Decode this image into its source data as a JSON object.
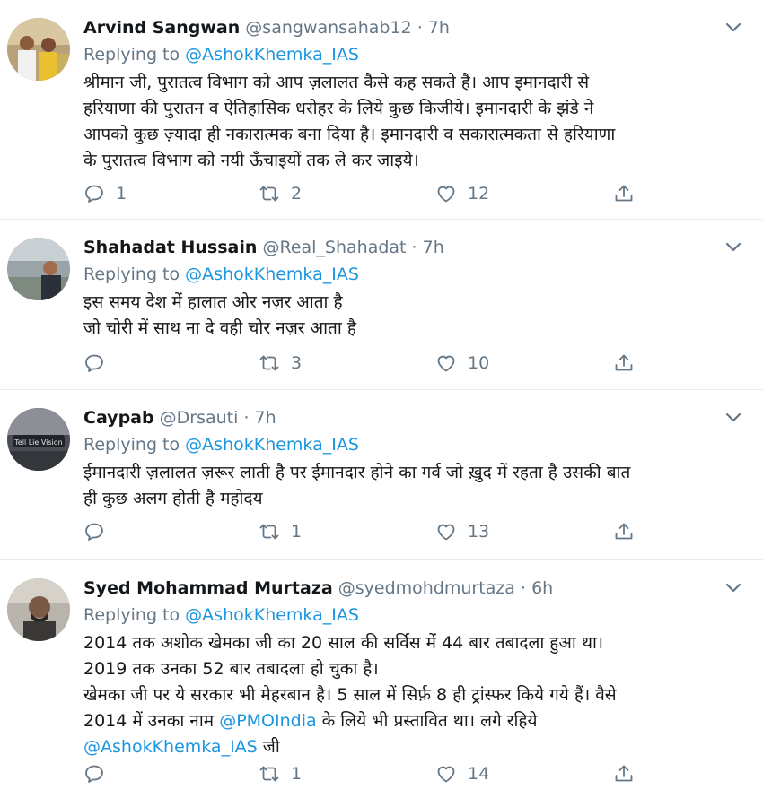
{
  "tweets": [
    {
      "name": "Arvind Sangwan",
      "handle": "@sangwansahab12",
      "sep": "·",
      "time": "7h",
      "replying_prefix": "Replying to",
      "replying_to": "@AshokKhemka_IAS",
      "lines": [
        "श्रीमान जी, पुरातत्व विभाग को आप ज़लालत कैसे कह सकते हैं। आप इमानदारी से",
        "हरियाणा की पुरातन व ऐतिहासिक धरोहर के लिये कुछ किजीये। इमानदारी के झंडे ने",
        "आपको कुछ ज़्यादा ही नकारात्मक बना दिया है। इमानदारी व सकारात्मकता से हरियाणा",
        "के पुरातत्व विभाग को नयी ऊँचाइयों तक ले कर जाइये।"
      ],
      "replies": "1",
      "retweets": "2",
      "likes": "12"
    },
    {
      "name": "Shahadat Hussain",
      "handle": "@Real_Shahadat",
      "sep": "·",
      "time": "7h",
      "replying_prefix": "Replying to",
      "replying_to": "@AshokKhemka_IAS",
      "lines": [
        "इस समय देश में  हालात ओर नज़र आता है",
        "जो चोरी में साथ ना दे वही चोर नज़र आता है"
      ],
      "replies": "",
      "retweets": "3",
      "likes": "10"
    },
    {
      "name": "Caypab",
      "handle": "@Drsauti",
      "sep": "·",
      "time": "7h",
      "replying_prefix": "Replying to",
      "replying_to": "@AshokKhemka_IAS",
      "lines": [
        "ईमानदारी ज़लालत ज़रूर लाती है पर ईमानदार होने का गर्व जो ख़ुद में रहता है उसकी बात",
        "ही कुछ अलग होती है महोदय"
      ],
      "replies": "",
      "retweets": "1",
      "likes": "13"
    },
    {
      "name": "Syed Mohammad Murtaza",
      "handle": "@syedmohdmurtaza",
      "sep": "·",
      "time": "6h",
      "replying_prefix": "Replying to",
      "replying_to": "@AshokKhemka_IAS",
      "lines": [
        "2014 तक अशोक खेमका जी का 20 साल की सर्विस में 44 बार तबादला हुआ था।",
        "2019 तक उनका 52 बार तबादला हो चुका है।",
        "खेमका जी पर ये सरकार भी मेहरबान है। 5 साल में सिर्फ़ 8 ही ट्रांस्फर किये गये हैं। वैसे"
      ],
      "line4_before": "2014 में उनका नाम ",
      "line4_mention": "@PMOIndia",
      "line4_after": " के लिये भी प्रस्तावित था। लगे रहिये",
      "line5_mention": "@AshokKhemka_IAS",
      "line5_after": " जी",
      "replies": "",
      "retweets": "1",
      "likes": "14"
    }
  ],
  "colors": {
    "text": "#14171a",
    "muted": "#657786",
    "link": "#1b95e0",
    "divider": "#e6ecf0"
  },
  "icons": {
    "reply": "reply-icon",
    "retweet": "retweet-icon",
    "like": "heart-icon",
    "share": "share-icon",
    "menu": "chevron-down-icon"
  }
}
